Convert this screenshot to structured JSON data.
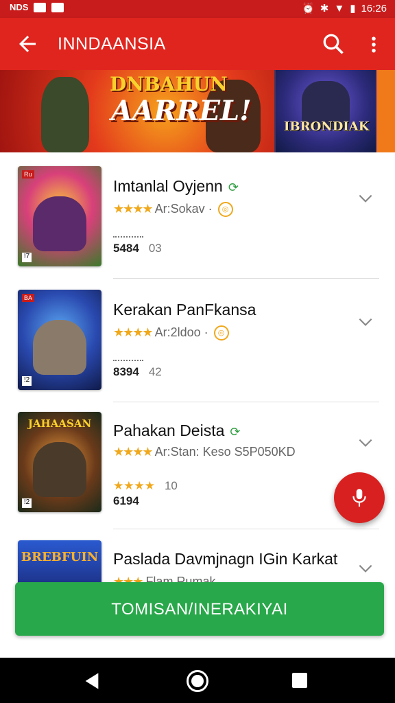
{
  "status_bar": {
    "left_text": "NDS",
    "time": "16:26"
  },
  "app_bar": {
    "title": "INNDAANSIA",
    "back_icon": "arrow-left-icon",
    "search_icon": "search-icon",
    "more_icon": "more-vert-icon"
  },
  "banner": {
    "headline_top": "DNBAHUN",
    "headline_main": "AARREL!",
    "side_title": "IBRONDIAK"
  },
  "games": [
    {
      "name": "Imtanlal Oyjenn",
      "stars": "★★★★",
      "meta": "Ar:Sokav ·",
      "count": "5484",
      "score": "03",
      "tag": "Ru",
      "logo": "",
      "has_leaf": true
    },
    {
      "name": "Kerakan PanFkansa",
      "stars": "★★★★",
      "meta": "Ar:2ldoo ·",
      "count": "8394",
      "score": "42",
      "tag": "BA",
      "logo": "",
      "has_leaf": false
    },
    {
      "name": "Pahakan Deista",
      "stars": "★★★★",
      "meta": "Ar:Stan: Keso S5P050KD",
      "count": "6194",
      "score": "10",
      "tag": "",
      "logo": "JAHAASAN",
      "has_leaf": true
    },
    {
      "name": "Paslada Davmjnagn IGin Karkat",
      "stars": "★★★",
      "meta": "Flam Rumak",
      "count": "",
      "score": "",
      "tag": "",
      "logo": "BREBFUIN",
      "has_leaf": false
    }
  ],
  "cta": {
    "label": "TOMISAN/INERAKIYAI"
  },
  "colors": {
    "primary": "#e0251f",
    "accent_green": "#28a84a",
    "star": "#f0a81c"
  }
}
